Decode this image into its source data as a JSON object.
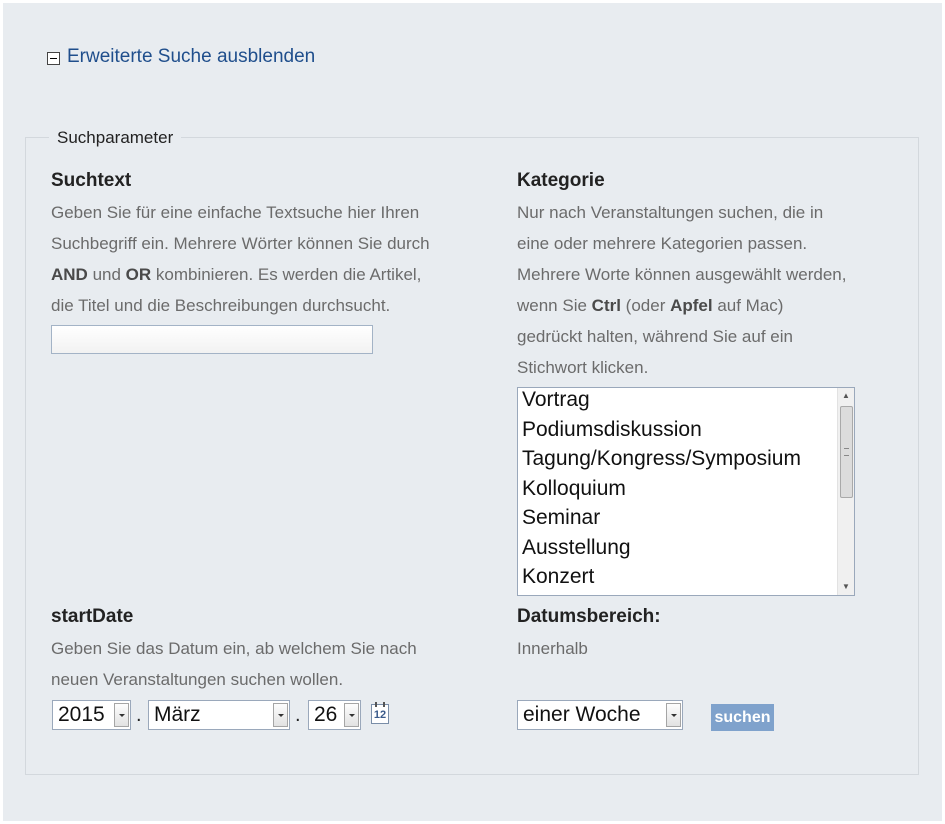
{
  "toggle": {
    "label": "Erweiterte Suche ausblenden"
  },
  "fieldset": {
    "legend": "Suchparameter"
  },
  "suchtext": {
    "heading": "Suchtext",
    "lines": [
      [
        "Geben Sie für eine einfache Textsuche hier Ihren"
      ],
      [
        "Suchbegriff ein. Mehrere Wörter können Sie durch"
      ],
      [
        "",
        "AND",
        " und ",
        "OR",
        " kombinieren. Es werden die Artikel,"
      ],
      [
        "die Titel und die Beschreibungen durchsucht."
      ]
    ],
    "input_value": ""
  },
  "kategorie": {
    "heading": "Kategorie",
    "lines": [
      [
        "Nur nach Veranstaltungen suchen, die in"
      ],
      [
        "eine oder mehrere Kategorien passen."
      ],
      [
        "Mehrere Worte können ausgewählt werden,"
      ],
      [
        "wenn Sie ",
        "Ctrl",
        " (oder ",
        "Apfel",
        " auf Mac)"
      ],
      [
        "gedrückt halten, während Sie auf ein"
      ],
      [
        "Stichwort klicken."
      ]
    ],
    "options": [
      "Vortrag",
      "Podiumsdiskussion",
      "Tagung/Kongress/Symposium",
      "Kolloquium",
      "Seminar",
      "Ausstellung",
      "Konzert"
    ]
  },
  "startdate": {
    "heading": "startDate",
    "lines": [
      [
        "Geben Sie das Datum ein, ab welchem Sie nach"
      ],
      [
        "neuen Veranstaltungen suchen wollen."
      ]
    ],
    "year": "2015",
    "month": "März",
    "day": "26",
    "separator": ".",
    "calendar_icon_number": "12"
  },
  "datumsbereich": {
    "heading": "Datumsbereich:",
    "lines": [
      [
        "Innerhalb"
      ]
    ],
    "range": "einer Woche"
  },
  "submit": {
    "label": "suchen"
  },
  "colors": {
    "background": "#e8ecf0",
    "link": "#1f4e8c",
    "button": "#7fa2cc"
  }
}
